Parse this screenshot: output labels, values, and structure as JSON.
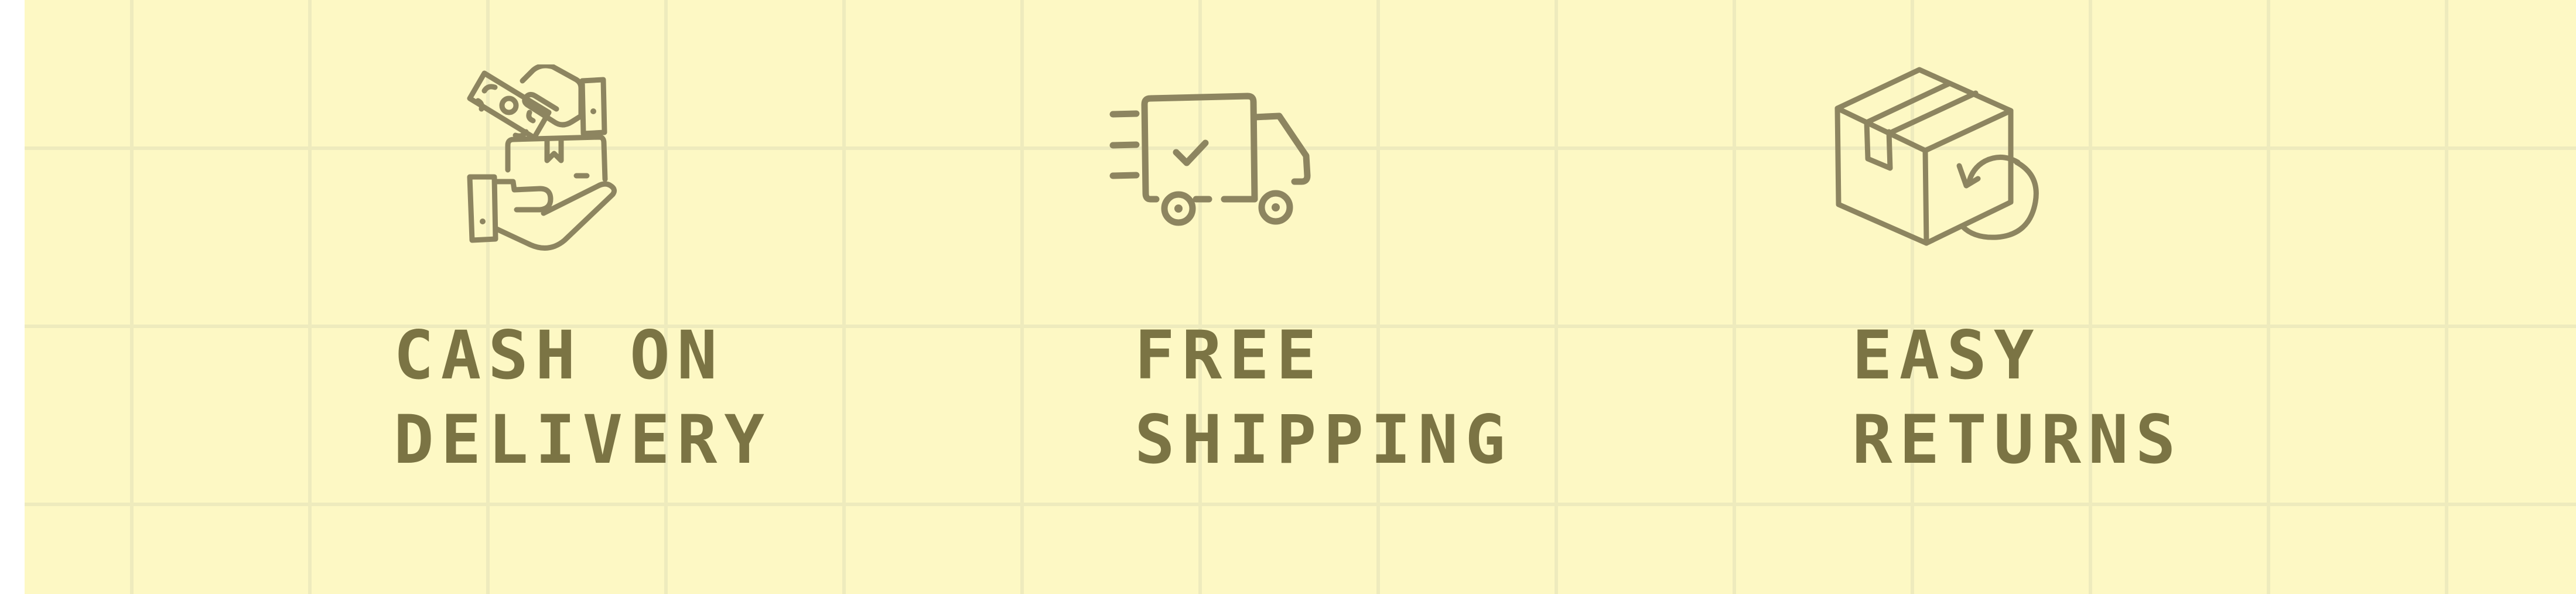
{
  "colors": {
    "background": "#fdf8c4",
    "grid_line": "#eeebbd",
    "icon_stroke": "#8d8560",
    "text": "#7b7444"
  },
  "features": [
    {
      "icon": "cash-on-delivery-icon",
      "line1": "CASH ON",
      "line2": "DELIVERY"
    },
    {
      "icon": "delivery-truck-icon",
      "line1": "FREE",
      "line2": "SHIPPING"
    },
    {
      "icon": "return-box-icon",
      "line1": "EASY",
      "line2": "RETURNS"
    }
  ]
}
